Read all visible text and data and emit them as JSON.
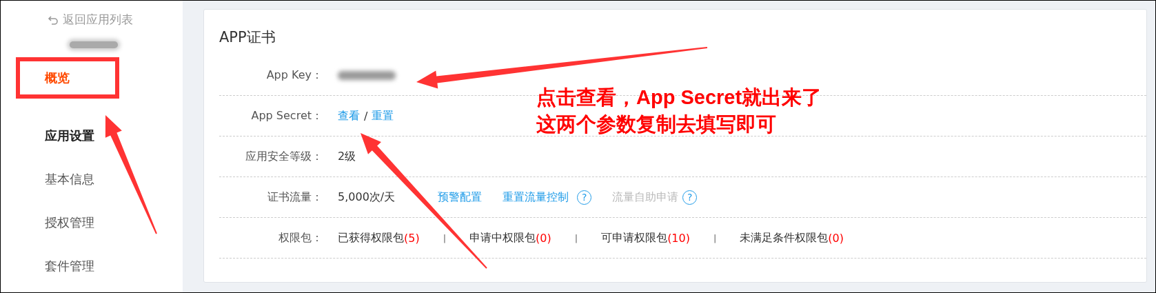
{
  "sidebar": {
    "back_link": "返回应用列表",
    "app_name": {
      "redacted": true
    },
    "items": [
      {
        "label": "概览",
        "kind": "item",
        "selected": true,
        "boxed": true
      },
      {
        "label": "应用设置",
        "kind": "group",
        "selected": false,
        "boxed": false
      },
      {
        "label": "基本信息",
        "kind": "item",
        "selected": false,
        "boxed": false
      },
      {
        "label": "授权管理",
        "kind": "item",
        "selected": false,
        "boxed": false
      },
      {
        "label": "套件管理",
        "kind": "item",
        "selected": false,
        "boxed": false
      }
    ]
  },
  "card": {
    "title": "APP证书",
    "rows": [
      {
        "label": "App Key：",
        "parts": [
          {
            "kind": "redacted"
          }
        ]
      },
      {
        "label": "App Secret：",
        "parts": [
          {
            "kind": "link",
            "text": "查看"
          },
          {
            "kind": "text",
            "text": "/"
          },
          {
            "kind": "link",
            "text": "重置"
          }
        ]
      },
      {
        "label": "应用安全等级：",
        "parts": [
          {
            "kind": "text",
            "text": "2级"
          }
        ]
      },
      {
        "label": "证书流量：",
        "parts": [
          {
            "kind": "text",
            "text": "5,000次/天"
          },
          {
            "kind": "link",
            "text": "预警配置"
          },
          {
            "kind": "link",
            "text": "重置流量控制"
          },
          {
            "kind": "help",
            "text": "?"
          },
          {
            "kind": "muted",
            "text": "流量自助申请"
          },
          {
            "kind": "help",
            "text": "?"
          }
        ]
      },
      {
        "label": "权限包：",
        "parts": [
          {
            "kind": "text",
            "text": "已获得权限包"
          },
          {
            "kind": "count",
            "text": "(5)"
          },
          {
            "kind": "sep",
            "text": "|"
          },
          {
            "kind": "text",
            "text": "申请中权限包"
          },
          {
            "kind": "count",
            "text": "(0)"
          },
          {
            "kind": "sep",
            "text": "|"
          },
          {
            "kind": "text",
            "text": "可申请权限包"
          },
          {
            "kind": "count",
            "text": "(10)"
          },
          {
            "kind": "sep",
            "text": "|"
          },
          {
            "kind": "text",
            "text": "未满足条件权限包"
          },
          {
            "kind": "count",
            "text": "(0)"
          }
        ]
      }
    ]
  },
  "annotation": {
    "lines": [
      "点击查看，App Secret就出来了",
      "这两个参数复制去填写即可"
    ]
  }
}
